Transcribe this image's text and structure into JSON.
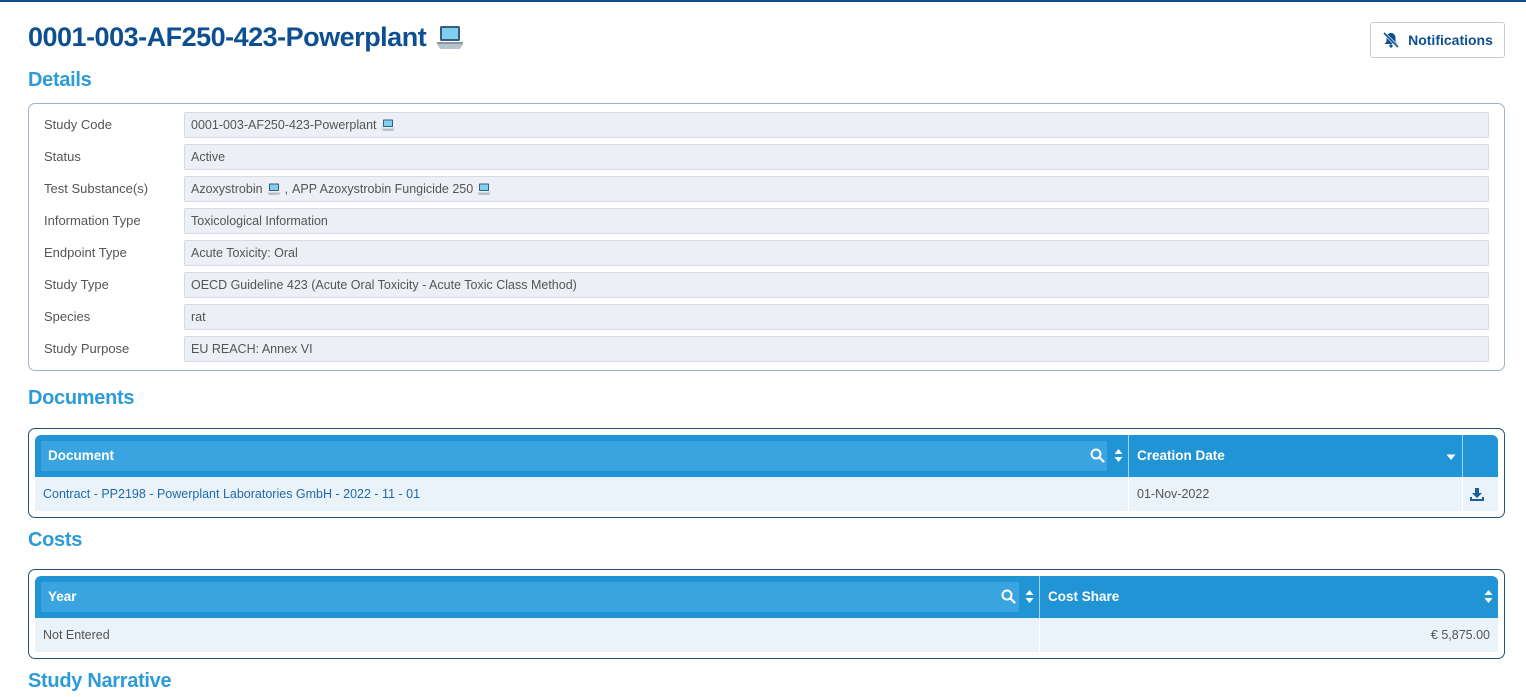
{
  "page": {
    "title": "0001-003-AF250-423-Powerplant",
    "title_icon": "laptop-icon",
    "notifications_label": "Notifications",
    "notifications_icon": "bell-slash-icon"
  },
  "details": {
    "heading": "Details",
    "rows": [
      {
        "label": "Study Code",
        "value": "0001-003-AF250-423-Powerplant"
      },
      {
        "label": "Status",
        "value": "Active"
      },
      {
        "label": "Test Substance(s)",
        "value_a": "Azoxystrobin",
        "value_sep": ",",
        "value_b": "APP Azoxystrobin Fungicide 250"
      },
      {
        "label": "Information Type",
        "value": "Toxicological Information"
      },
      {
        "label": "Endpoint Type",
        "value": "Acute Toxicity: Oral"
      },
      {
        "label": "Study Type",
        "value": "OECD Guideline 423 (Acute Oral Toxicity - Acute Toxic Class Method)"
      },
      {
        "label": "Species",
        "value": "rat"
      },
      {
        "label": "Study Purpose",
        "value": "EU REACH: Annex VI"
      }
    ]
  },
  "documents": {
    "heading": "Documents",
    "columns": [
      "Document",
      "Creation Date"
    ],
    "rows": [
      {
        "document": "Contract - PP2198 - Powerplant Laboratories GmbH - 2022 - 11 - 01",
        "creation_date": "01-Nov-2022",
        "action_icon": "download-icon"
      }
    ]
  },
  "costs": {
    "heading": "Costs",
    "columns": [
      "Year",
      "Cost Share"
    ],
    "rows": [
      {
        "year": "Not Entered",
        "cost_share": "€ 5,875.00"
      }
    ]
  },
  "narrative": {
    "heading": "Study Narrative"
  },
  "colors": {
    "title": "#0d4f91",
    "section_heading": "#2d9bd6",
    "table_header": "#2194d6",
    "row_background": "#eaf3fa"
  }
}
